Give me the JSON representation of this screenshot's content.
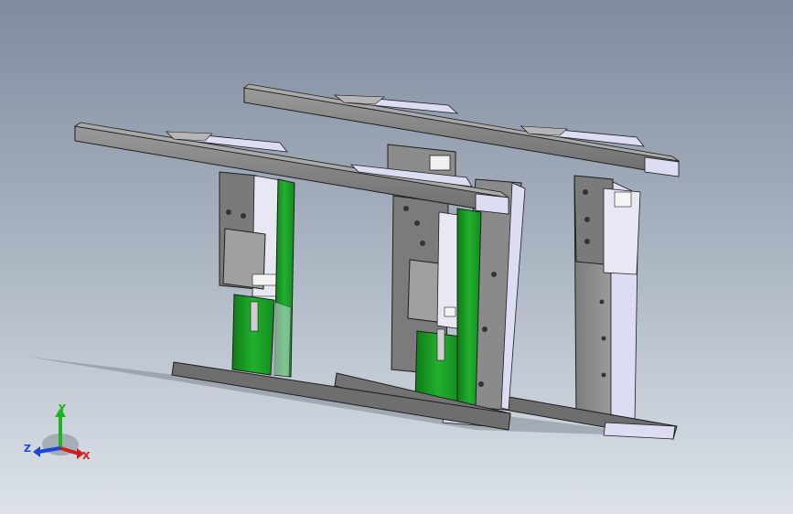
{
  "viewport": {
    "background_top": "#7f8c9e",
    "background_bottom": "#dde2e9"
  },
  "model": {
    "colors": {
      "steel": "#8c8c8c",
      "steel_dark": "#5d5d5d",
      "steel_light": "#b5b5b5",
      "guide_green": "#1fa32a",
      "guide_green_dark": "#0f6e18",
      "plastic": "#dcdcf2",
      "edge": "#1e1e1e"
    }
  },
  "triad": {
    "x_label": "X",
    "y_label": "Y",
    "z_label": "Z",
    "x_color": "#d21e1e",
    "y_color": "#1eb41e",
    "z_color": "#1e46d2"
  }
}
